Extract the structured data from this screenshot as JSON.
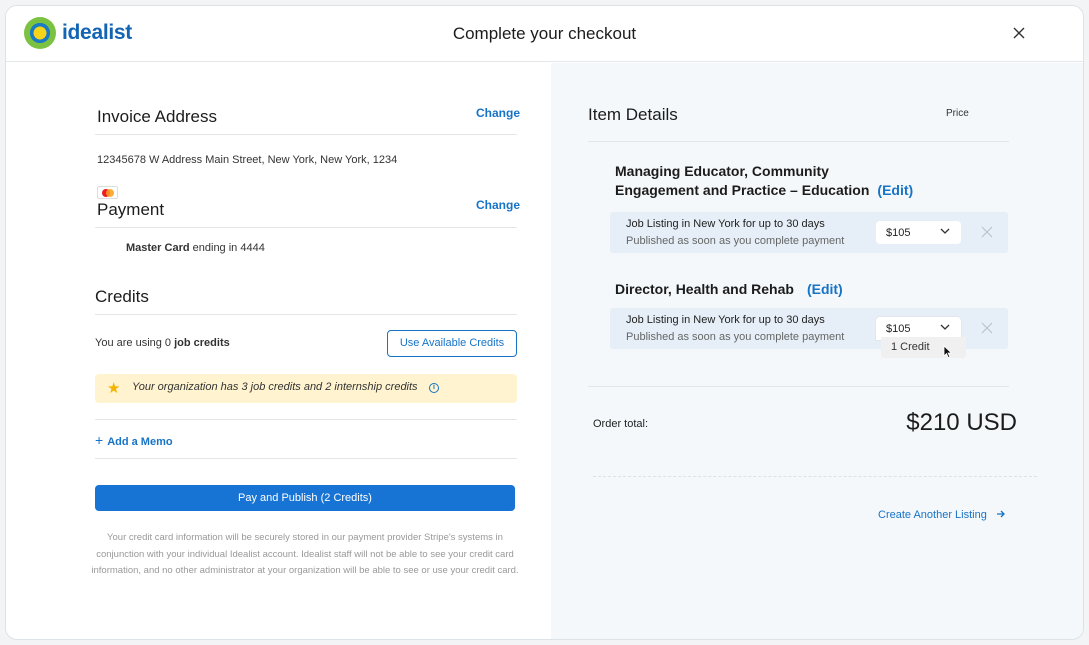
{
  "header": {
    "brand": "idealist",
    "title": "Complete your checkout"
  },
  "invoice": {
    "title": "Invoice Address",
    "change_label": "Change",
    "address": "12345678 W Address Main Street, New York, New York, 1234"
  },
  "payment": {
    "title": "Payment",
    "change_label": "Change",
    "card_brand": "Master Card",
    "card_suffix": "ending in 4444"
  },
  "credits": {
    "title": "Credits",
    "using_prefix": "You are using 0",
    "using_bold": "job credits",
    "use_button": "Use Available Credits",
    "notice": "Your organization has 3 job credits and 2 internship credits"
  },
  "memo": {
    "label": "Add a Memo"
  },
  "pay_button": "Pay and Publish (2 Credits)",
  "disclaimer": "Your credit card information will be securely stored in our payment provider Stripe's systems in conjunction with your individual Idealist account. Idealist  staff will not be able to see your credit card information, and no other administrator at your organization will be able to see or use your credit card.",
  "items": {
    "title": "Item Details",
    "price_header": "Price",
    "list": [
      {
        "title_line1": "Managing Educator, Community",
        "title_line2": "Engagement and Practice – Education",
        "edit": "(Edit)",
        "line1": "Job Listing in New York for up to 30 days",
        "line2": "Published as soon as you complete payment",
        "price": "$105"
      },
      {
        "title_line1": "Director, Health and Rehab",
        "edit": "(Edit)",
        "line1": "Job Listing in New York for up to 30 days",
        "line2": "Published as soon as you complete payment",
        "price": "$105",
        "dropdown_option": "1 Credit"
      }
    ]
  },
  "order": {
    "total_label": "Order total:",
    "total_value": "$210 USD"
  },
  "create_link": "Create Another Listing",
  "colors": {
    "accent": "#1773c6",
    "pay_button": "#1773d4",
    "notice_bg": "#fff4cf",
    "right_panel_bg": "#f4f8fb",
    "item_row_bg": "#e6eff7"
  }
}
